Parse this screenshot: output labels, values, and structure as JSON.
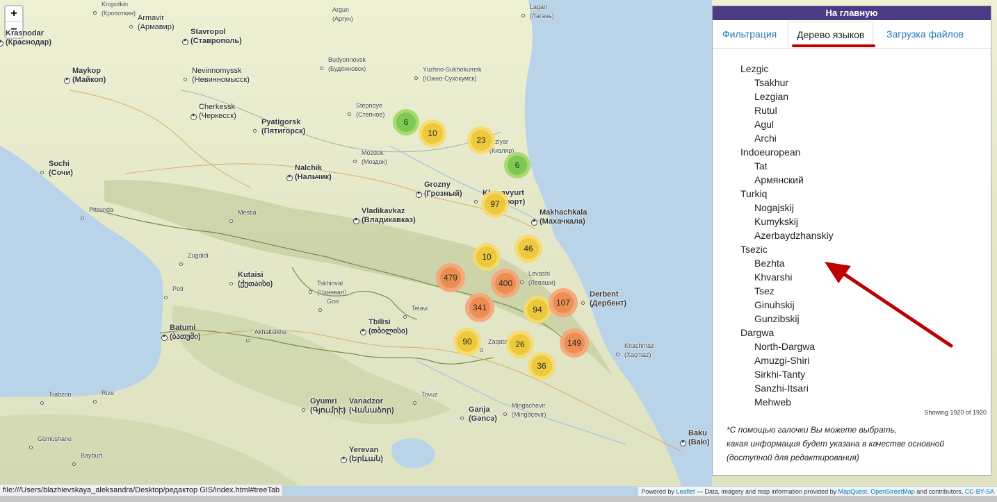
{
  "map": {
    "zoom_in": "+",
    "zoom_out": "−",
    "cities": [
      {
        "name": "Krasnodar",
        "alt": "(Краснодар)",
        "type": "capital",
        "cls": "big"
      },
      {
        "name": "Armavir",
        "alt": "(Армавир)",
        "type": "dot",
        "cls": ""
      },
      {
        "name": "Stavropol",
        "alt": "(Ставрополь)",
        "type": "capital",
        "cls": "big"
      },
      {
        "name": "Maykop",
        "alt": "(Майкоп)",
        "type": "capital",
        "cls": "big"
      },
      {
        "name": "Nevinnomyssk",
        "alt": "(Невинномысск)",
        "type": "dot",
        "cls": ""
      },
      {
        "name": "Cherkessk",
        "alt": "(Черкесск)",
        "type": "capital",
        "cls": ""
      },
      {
        "name": "Pyatigorsk",
        "alt": "(Пятигорск)",
        "type": "dot",
        "cls": "big"
      },
      {
        "name": "Nalchik",
        "alt": "(Нальчик)",
        "type": "capital",
        "cls": "big"
      },
      {
        "name": "Sochi",
        "alt": "(Сочи)",
        "type": "dot",
        "cls": "big"
      },
      {
        "name": "Grozny",
        "alt": "(Грозный)",
        "type": "capital",
        "cls": "big"
      },
      {
        "name": "Khasavyurt",
        "alt": "(Хасавюрт)",
        "type": "dot",
        "cls": "big"
      },
      {
        "name": "Vladikavkaz",
        "alt": "(Владикавказ)",
        "type": "capital",
        "cls": "big"
      },
      {
        "name": "Makhachkala",
        "alt": "(Махачкала)",
        "type": "capital",
        "cls": "big"
      },
      {
        "name": "Derbent",
        "alt": "(Дербент)",
        "type": "dot",
        "cls": "big"
      },
      {
        "name": "Kutaisi",
        "alt": "(ქუთაისი)",
        "type": "dot",
        "cls": "big"
      },
      {
        "name": "Batumi",
        "alt": "(ბათუმი)",
        "type": "capital",
        "cls": "big"
      },
      {
        "name": "Tbilisi",
        "alt": "(თბილისი)",
        "type": "capital",
        "cls": "big"
      },
      {
        "name": "Gyumri",
        "alt": "(Գյումրի)",
        "type": "dot",
        "cls": "big"
      },
      {
        "name": "Vanadzor",
        "alt": "(Վանաձոր)",
        "type": "dot",
        "cls": "big"
      },
      {
        "name": "Yerevan",
        "alt": "(Երևան)",
        "type": "capital",
        "cls": "big"
      },
      {
        "name": "Ganja",
        "alt": "(Gəncə)",
        "type": "dot",
        "cls": "big"
      },
      {
        "name": "Baku",
        "alt": "(Bakı)",
        "type": "capital",
        "cls": "big"
      },
      {
        "name": "Kropotkin",
        "alt": "(Кропоткин)",
        "type": "dot",
        "cls": "small"
      },
      {
        "name": "Argun",
        "alt": "(Аргун)",
        "type": "",
        "cls": "small"
      },
      {
        "name": "Lagan",
        "alt": "(Лагань)",
        "type": "dot",
        "cls": "small"
      },
      {
        "name": "Budyonnovsk",
        "alt": "(Будённовск)",
        "type": "dot",
        "cls": "small"
      },
      {
        "name": "Yuzhno-Sukhokumsk",
        "alt": "(Южно-Сухокумск)",
        "type": "dot",
        "cls": "small"
      },
      {
        "name": "Stepnoye",
        "alt": "(Степное)",
        "type": "dot",
        "cls": "small"
      },
      {
        "name": "Mozdok",
        "alt": "(Моздок)",
        "type": "dot",
        "cls": "small"
      },
      {
        "name": "Kizlyar",
        "alt": "(Кизляр)",
        "type": "dot",
        "cls": "small"
      },
      {
        "name": "Pitsunda",
        "alt": "",
        "type": "dot",
        "cls": "small"
      },
      {
        "name": "Mestia",
        "alt": "",
        "type": "dot",
        "cls": "small"
      },
      {
        "name": "Zugdidi",
        "alt": "",
        "type": "dot",
        "cls": "small"
      },
      {
        "name": "Poti",
        "alt": "",
        "type": "dot",
        "cls": "small"
      },
      {
        "name": "Tskhinval",
        "alt": "(Цхинвал)",
        "type": "dot",
        "cls": "small"
      },
      {
        "name": "Gori",
        "alt": "",
        "type": "dot",
        "cls": "small"
      },
      {
        "name": "Telavi",
        "alt": "",
        "type": "dot",
        "cls": "small"
      },
      {
        "name": "Akhaltsikhe",
        "alt": "",
        "type": "dot",
        "cls": "small"
      },
      {
        "name": "Zaqatala",
        "alt": "",
        "type": "dot",
        "cls": "small"
      },
      {
        "name": "Mingachevir",
        "alt": "(Mingəçevir)",
        "type": "dot",
        "cls": "small"
      },
      {
        "name": "Trabzon",
        "alt": "",
        "type": "dot",
        "cls": "small"
      },
      {
        "name": "Rize",
        "alt": "",
        "type": "dot",
        "cls": "small"
      },
      {
        "name": "Gümüşhane",
        "alt": "",
        "type": "dot",
        "cls": "small"
      },
      {
        "name": "Bayburt",
        "alt": "",
        "type": "dot",
        "cls": "small"
      },
      {
        "name": "Khachmaz",
        "alt": "(Xaçmaz)",
        "type": "dot",
        "cls": "small"
      },
      {
        "name": "Tovuz",
        "alt": "",
        "type": "dot",
        "cls": "small"
      },
      {
        "name": "Levashi",
        "alt": "(Леваши)",
        "type": "dot",
        "cls": "small"
      }
    ],
    "clusters": [
      {
        "count": "6",
        "level": "small"
      },
      {
        "count": "10",
        "level": "medium"
      },
      {
        "count": "23",
        "level": "medium"
      },
      {
        "count": "6",
        "level": "small"
      },
      {
        "count": "97",
        "level": "medium"
      },
      {
        "count": "46",
        "level": "medium"
      },
      {
        "count": "10",
        "level": "medium"
      },
      {
        "count": "479",
        "level": "large"
      },
      {
        "count": "400",
        "level": "large"
      },
      {
        "count": "341",
        "level": "large"
      },
      {
        "count": "94",
        "level": "medium"
      },
      {
        "count": "107",
        "level": "large"
      },
      {
        "count": "90",
        "level": "medium"
      },
      {
        "count": "26",
        "level": "medium"
      },
      {
        "count": "149",
        "level": "large"
      },
      {
        "count": "36",
        "level": "medium"
      }
    ],
    "cluster_colors": {
      "small": {
        "outer": "#a6d96a",
        "inner": "#78c84c"
      },
      "medium": {
        "outer": "#f7dc6f",
        "inner": "#f0c836"
      },
      "large": {
        "outer": "#f6a77b",
        "inner": "#ee8a4e"
      }
    }
  },
  "panel": {
    "home_label": "На главную",
    "tabs": [
      {
        "label": "Фильтрация",
        "active": false
      },
      {
        "label": "Дерево языков",
        "active": true
      },
      {
        "label": "Загрузка файлов",
        "active": false
      }
    ],
    "tree": [
      {
        "group": "Lezgic",
        "items": [
          "Tsakhur",
          "Lezgian",
          "Rutul",
          "Agul",
          "Archi"
        ]
      },
      {
        "group": "Indoeuropean",
        "items": [
          "Tat",
          "Армянский"
        ]
      },
      {
        "group": "Turkiq",
        "items": [
          "Nogajskij",
          "Kumykskij",
          "Azerbaydzhanskiy"
        ]
      },
      {
        "group": "Tsezic",
        "items": [
          "Bezhta",
          "Khvarshi",
          "Tsez",
          "Ginuhskij",
          "Gunzibskij"
        ]
      },
      {
        "group": "Dargwa",
        "items": [
          "North-Dargwa",
          "Amuzgi-Shiri",
          "Sirkhi-Tanty",
          "Sanzhi-Itsari",
          "Mehweb"
        ]
      }
    ],
    "showing": "Showing 1920 of 1920",
    "note_lines": [
      "*С помощью галочки Вы можете выбрать,",
      "какая информация будет указана в качестве основной",
      "(доступной для редактирования)"
    ]
  },
  "status_url": "file:///Users/blazhievskaya_aleksandra/Desktop/редактор  GIS/index.html#treeTab",
  "attribution": {
    "powered_by": "Powered by",
    "leaflet": "Leaflet",
    "middle": "— Data, imagery and map information provided by",
    "mapquest": "MapQuest",
    "comma": ",",
    "osm": "OpenStreetMap",
    "and": "and contributors,",
    "license": "CC-BY-SA"
  },
  "colors": {
    "sea": "#b9d3e8",
    "plain": "#eef0d8",
    "mountain": "#c9d2a8",
    "header": "#4a3b84",
    "underline": "#c00000",
    "arrow": "#c00000",
    "link": "#1f78b4"
  }
}
